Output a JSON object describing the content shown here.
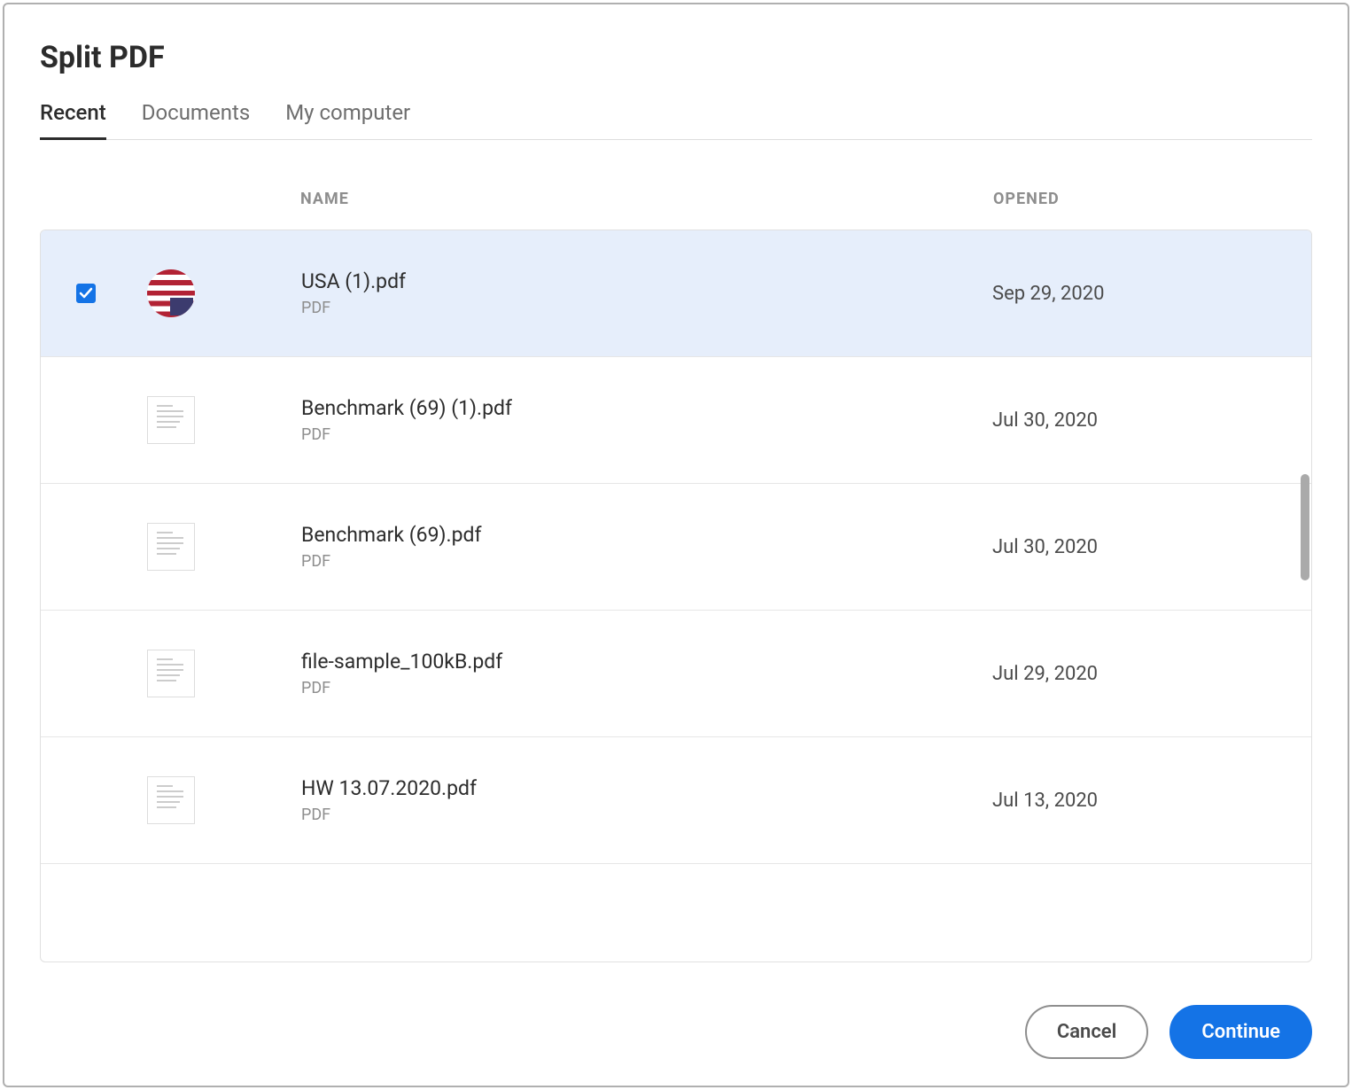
{
  "title": "Split PDF",
  "tabs": [
    {
      "label": "Recent",
      "active": true
    },
    {
      "label": "Documents",
      "active": false
    },
    {
      "label": "My computer",
      "active": false
    }
  ],
  "columns": {
    "name": "NAME",
    "opened": "OPENED"
  },
  "files": [
    {
      "name": "USA (1).pdf",
      "type": "PDF",
      "opened": "Sep 29, 2020",
      "selected": true,
      "thumb": "flag"
    },
    {
      "name": "Benchmark (69) (1).pdf",
      "type": "PDF",
      "opened": "Jul 30, 2020",
      "selected": false,
      "thumb": "doc"
    },
    {
      "name": "Benchmark (69).pdf",
      "type": "PDF",
      "opened": "Jul 30, 2020",
      "selected": false,
      "thumb": "doc"
    },
    {
      "name": "file-sample_100kB.pdf",
      "type": "PDF",
      "opened": "Jul 29, 2020",
      "selected": false,
      "thumb": "doc"
    },
    {
      "name": "HW 13.07.2020.pdf",
      "type": "PDF",
      "opened": "Jul 13, 2020",
      "selected": false,
      "thumb": "doc"
    }
  ],
  "buttons": {
    "cancel": "Cancel",
    "continue": "Continue"
  }
}
